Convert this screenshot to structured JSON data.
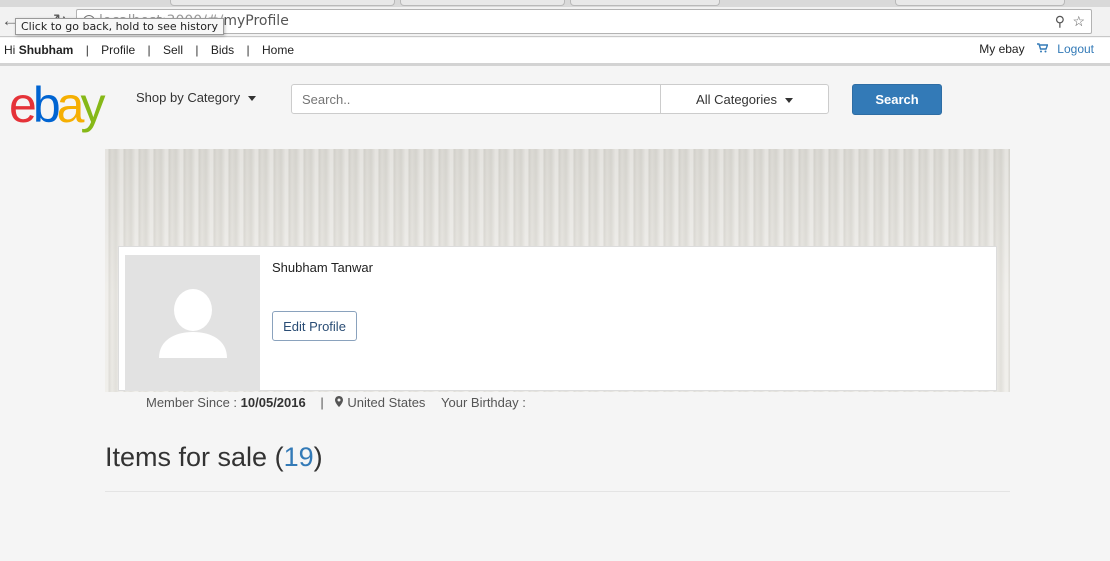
{
  "browser": {
    "url_faded": "localhost:3000/#/",
    "url_path": "myProfile",
    "tooltip": "Click to go back, hold to see history"
  },
  "topnav": {
    "greeting": "Hi",
    "username": "Shubham",
    "links": [
      "Profile",
      "Sell",
      "Bids",
      "Home"
    ],
    "my_ebay": "My ebay",
    "logout": "Logout"
  },
  "header": {
    "logo": "ebay",
    "shop_by_category": "Shop by Category",
    "search_placeholder": "Search..",
    "category_selected": "All Categories",
    "search_button": "Search"
  },
  "profile": {
    "name": "Shubham Tanwar",
    "edit_button": "Edit Profile",
    "member_since_label": "Member Since : ",
    "member_since_date": "10/05/2016",
    "location": "United States",
    "birthday_label": "Your Birthday :"
  },
  "items": {
    "heading": "Items for sale",
    "count": "19"
  },
  "colors": {
    "link_blue": "#337ab7",
    "ebay_red": "#e53238",
    "ebay_blue": "#0064d2",
    "ebay_yellow": "#f5af02",
    "ebay_green": "#86b817"
  }
}
